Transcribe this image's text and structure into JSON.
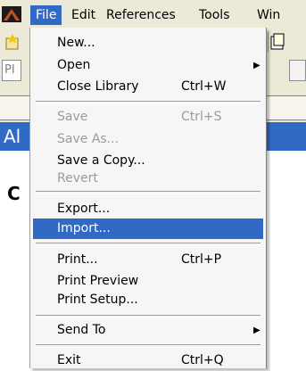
{
  "menubar": {
    "items": [
      {
        "label": "File"
      },
      {
        "label": "Edit"
      },
      {
        "label": "References"
      },
      {
        "label": "Tools"
      },
      {
        "label": "Win"
      }
    ]
  },
  "background": {
    "toolbar_field_text": "PI",
    "blue_bar_text": "Al",
    "content_text": "C"
  },
  "file_menu": {
    "new": {
      "label": "New..."
    },
    "open": {
      "label": "Open"
    },
    "close_library": {
      "label": "Close Library",
      "shortcut": "Ctrl+W"
    },
    "save": {
      "label": "Save",
      "shortcut": "Ctrl+S"
    },
    "save_as": {
      "label": "Save As..."
    },
    "save_copy": {
      "label": "Save a Copy..."
    },
    "revert": {
      "label": "Revert"
    },
    "export": {
      "label": "Export..."
    },
    "import": {
      "label": "Import..."
    },
    "print": {
      "label": "Print...",
      "shortcut": "Ctrl+P"
    },
    "print_preview": {
      "label": "Print Preview"
    },
    "print_setup": {
      "label": "Print Setup..."
    },
    "send_to": {
      "label": "Send To"
    },
    "exit": {
      "label": "Exit",
      "shortcut": "Ctrl+Q"
    }
  },
  "colors": {
    "highlight": "#316ac5",
    "menu_bg": "#f6f6f6",
    "chrome_bg": "#ece9d8",
    "disabled_text": "#9a9a9a"
  }
}
